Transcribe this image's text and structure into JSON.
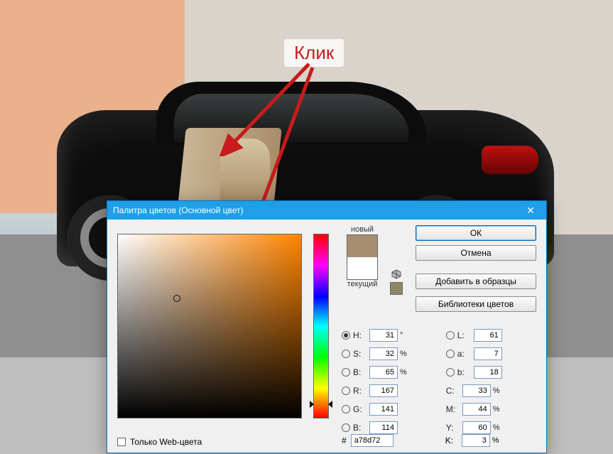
{
  "annotation": {
    "label": "Клик"
  },
  "dialog": {
    "title": "Палитра цветов (Основной цвет)",
    "buttons": {
      "ok": "ОК",
      "cancel": "Отмена",
      "add_swatch": "Добавить в образцы",
      "libraries": "Библиотеки цветов"
    },
    "swatch": {
      "new_label": "новый",
      "current_label": "текущий",
      "new_color": "#a78d72",
      "current_color": "#ffffff"
    },
    "only_web": {
      "label": "Только Web-цвета",
      "checked": false
    },
    "hex": {
      "prefix": "#",
      "value": "a78d72"
    },
    "fields": {
      "H": {
        "label": "H:",
        "value": "31",
        "unit": "°",
        "selected": true
      },
      "S": {
        "label": "S:",
        "value": "32",
        "unit": "%",
        "selected": false
      },
      "Bv": {
        "label": "B:",
        "value": "65",
        "unit": "%",
        "selected": false
      },
      "R": {
        "label": "R:",
        "value": "167",
        "unit": "",
        "selected": false
      },
      "G": {
        "label": "G:",
        "value": "141",
        "unit": "",
        "selected": false
      },
      "Bb": {
        "label": "B:",
        "value": "114",
        "unit": "",
        "selected": false
      },
      "L": {
        "label": "L:",
        "value": "61",
        "unit": "",
        "selected": false
      },
      "a": {
        "label": "a:",
        "value": "7",
        "unit": "",
        "selected": false
      },
      "b": {
        "label": "b:",
        "value": "18",
        "unit": "",
        "selected": false
      },
      "C": {
        "label": "C:",
        "value": "33",
        "unit": "%"
      },
      "M": {
        "label": "M:",
        "value": "44",
        "unit": "%"
      },
      "Y": {
        "label": "Y:",
        "value": "60",
        "unit": "%"
      },
      "K": {
        "label": "K:",
        "value": "3",
        "unit": "%"
      }
    }
  }
}
